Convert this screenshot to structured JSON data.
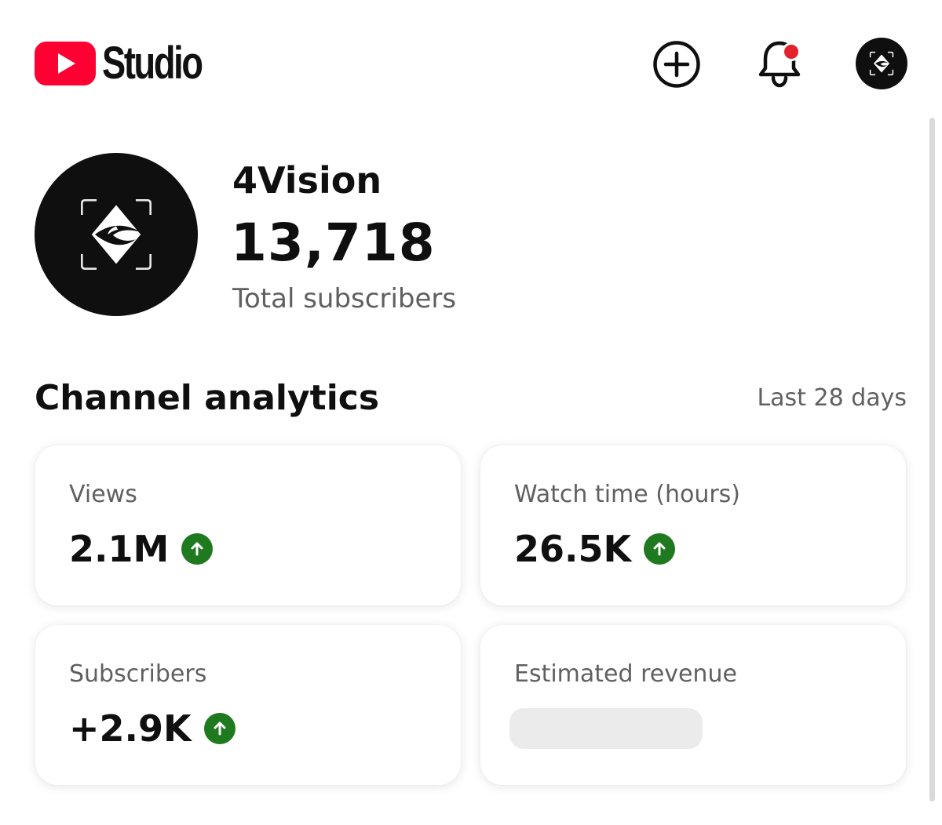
{
  "header": {
    "logo_text": "Studio",
    "icons": {
      "create": "add-circle-icon",
      "notifications": "bell-icon",
      "account": "channel-avatar-icon"
    },
    "has_unread_notifications": true,
    "brand_color": "#ff0033"
  },
  "channel": {
    "name": "4Vision",
    "subscriber_count": "13,718",
    "subscriber_label": "Total subscribers"
  },
  "analytics": {
    "title": "Channel analytics",
    "period": "Last 28 days",
    "cards": [
      {
        "label": "Views",
        "value": "2.1M",
        "trend": "up"
      },
      {
        "label": "Watch time (hours)",
        "value": "26.5K",
        "trend": "up"
      },
      {
        "label": "Subscribers",
        "value": "+2.9K",
        "trend": "up"
      },
      {
        "label": "Estimated revenue",
        "value": null,
        "trend": null
      }
    ],
    "trend_up_color": "#1f7a1f"
  }
}
